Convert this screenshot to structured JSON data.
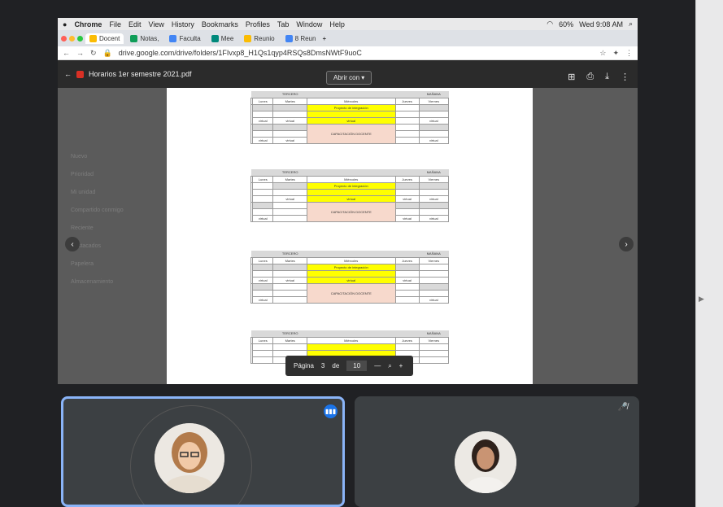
{
  "menubar": {
    "app": "Chrome",
    "items": [
      "File",
      "Edit",
      "View",
      "History",
      "Bookmarks",
      "Profiles",
      "Tab",
      "Window",
      "Help"
    ],
    "battery": "60%",
    "datetime": "Wed 9:08 AM"
  },
  "tabs": [
    "Docent",
    "Notas,",
    "Faculta",
    "Mee",
    "Reunio",
    "8 Reun"
  ],
  "address": {
    "url": "drive.google.com/drive/folders/1FIvxp8_H1Qs1qyp4RSQs8DmsNWtF9uoC"
  },
  "viewer": {
    "filename": "Horarios 1er semestre 2021.pdf",
    "open_with": "Abrir con",
    "page_label": "Página",
    "page": "3",
    "of_label": "de",
    "total": "10"
  },
  "schedule": {
    "days": [
      "Lunes",
      "Martes",
      "Miércoles",
      "Jueves",
      "Viernes"
    ],
    "curso": "TERCERO",
    "turno": "MAÑANA",
    "capacitacion": "CAPACITACIÓN DOCENTE",
    "virtual": "virtual",
    "proyecto": "Proyecto de integración"
  },
  "drive_bg": {
    "left": [
      "Nuevo",
      "Prioridad",
      "Mi unidad",
      "Compartido conmigo",
      "Reciente",
      "Destacados",
      "Papelera",
      "Almacenamiento"
    ]
  }
}
